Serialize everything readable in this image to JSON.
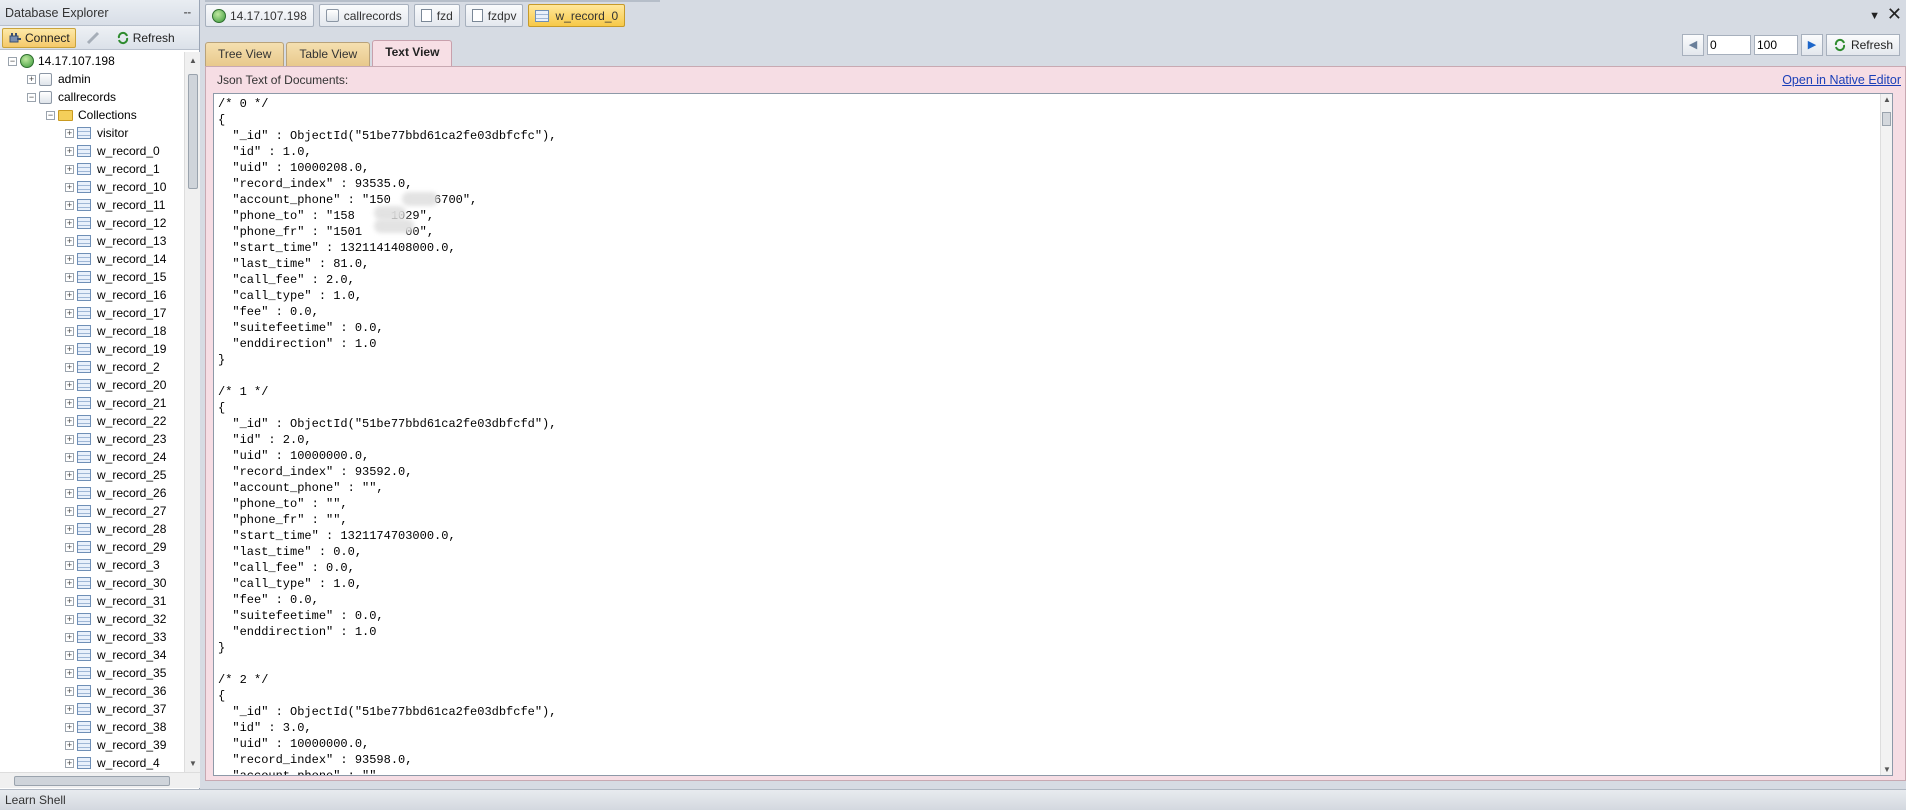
{
  "explorer": {
    "title": "Database Explorer",
    "connect_label": "Connect",
    "refresh_label": "Refresh",
    "server": "14.17.107.198",
    "databases": [
      "admin",
      "callrecords"
    ],
    "collections_label": "Collections",
    "collections": [
      "visitor",
      "w_record_0",
      "w_record_1",
      "w_record_10",
      "w_record_11",
      "w_record_12",
      "w_record_13",
      "w_record_14",
      "w_record_15",
      "w_record_16",
      "w_record_17",
      "w_record_18",
      "w_record_19",
      "w_record_2",
      "w_record_20",
      "w_record_21",
      "w_record_22",
      "w_record_23",
      "w_record_24",
      "w_record_25",
      "w_record_26",
      "w_record_27",
      "w_record_28",
      "w_record_29",
      "w_record_3",
      "w_record_30",
      "w_record_31",
      "w_record_32",
      "w_record_33",
      "w_record_34",
      "w_record_35",
      "w_record_36",
      "w_record_37",
      "w_record_38",
      "w_record_39",
      "w_record_4"
    ]
  },
  "doc_tabs": [
    "14.17.107.198",
    "callrecords",
    "fzd",
    "fzdpv",
    "w_record_0"
  ],
  "view_tabs": [
    "Tree View",
    "Table View",
    "Text View"
  ],
  "pager": {
    "skip": "0",
    "limit": "100",
    "refresh_label": "Refresh"
  },
  "content": {
    "header": "Json Text of Documents:",
    "native_link": "Open in Native Editor"
  },
  "json_text": "/* 0 */\n{\n  \"_id\" : ObjectId(\"51be77bbd61ca2fe03dbfcfc\"),\n  \"id\" : 1.0,\n  \"uid\" : 10000208.0,\n  \"record_index\" : 93535.0,\n  \"account_phone\" : \"150      6700\",\n  \"phone_to\" : \"158     1029\",\n  \"phone_fr\" : \"1501      00\",\n  \"start_time\" : 1321141408000.0,\n  \"last_time\" : 81.0,\n  \"call_fee\" : 2.0,\n  \"call_type\" : 1.0,\n  \"fee\" : 0.0,\n  \"suitefeetime\" : 0.0,\n  \"enddirection\" : 1.0\n}\n\n/* 1 */\n{\n  \"_id\" : ObjectId(\"51be77bbd61ca2fe03dbfcfd\"),\n  \"id\" : 2.0,\n  \"uid\" : 10000000.0,\n  \"record_index\" : 93592.0,\n  \"account_phone\" : \"\",\n  \"phone_to\" : \"\",\n  \"phone_fr\" : \"\",\n  \"start_time\" : 1321174703000.0,\n  \"last_time\" : 0.0,\n  \"call_fee\" : 0.0,\n  \"call_type\" : 1.0,\n  \"fee\" : 0.0,\n  \"suitefeetime\" : 0.0,\n  \"enddirection\" : 1.0\n}\n\n/* 2 */\n{\n  \"_id\" : ObjectId(\"51be77bbd61ca2fe03dbfcfe\"),\n  \"id\" : 3.0,\n  \"uid\" : 10000000.0,\n  \"record_index\" : 93598.0,\n  \"account_phone\" : \"\",",
  "status": "Learn Shell"
}
